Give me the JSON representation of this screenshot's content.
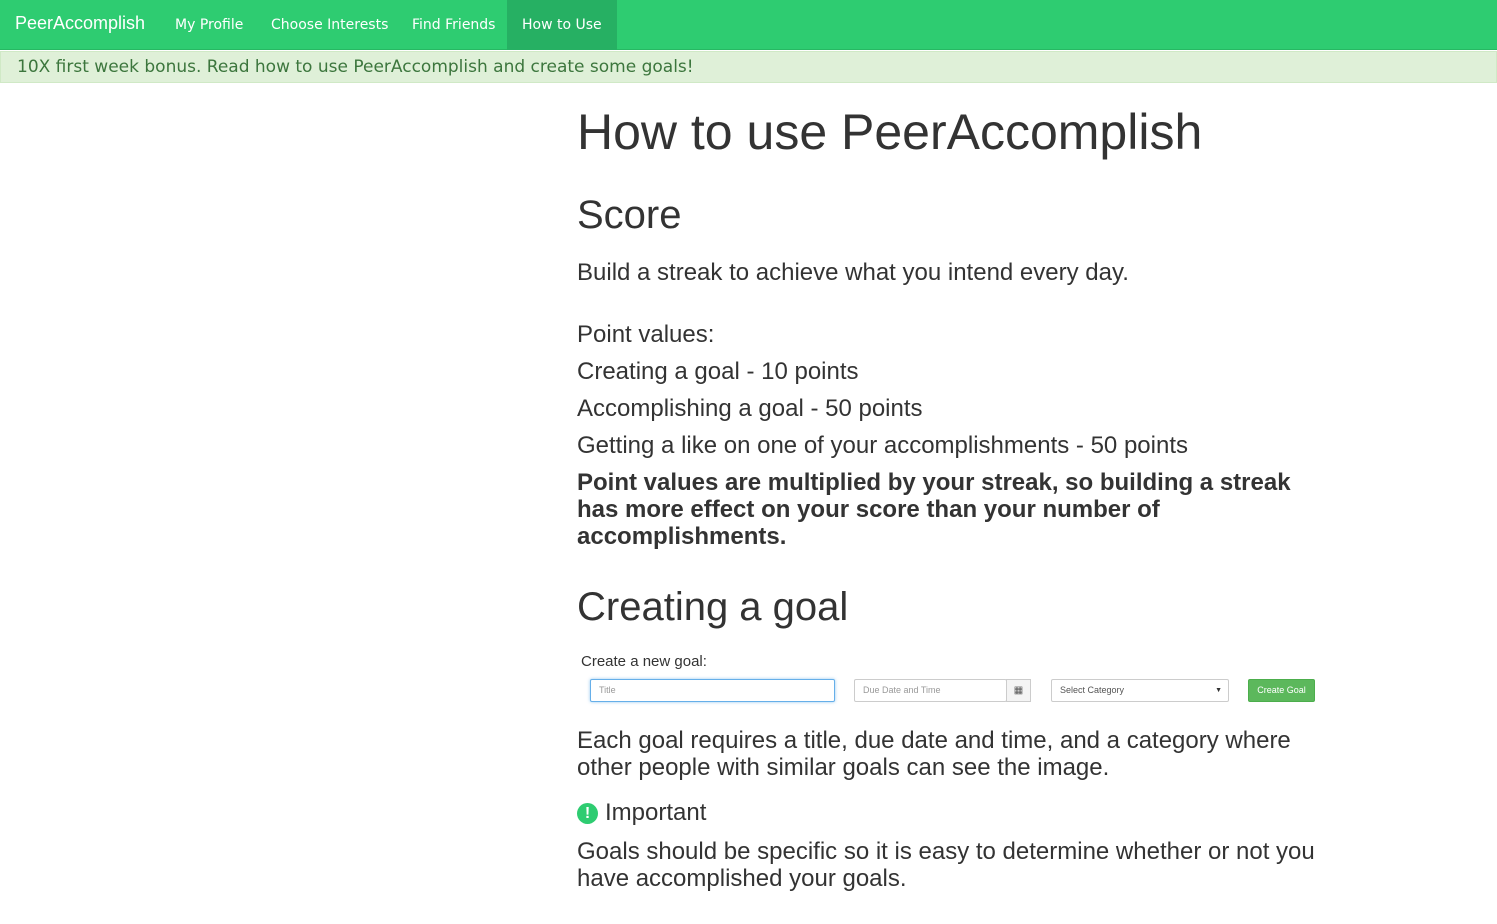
{
  "nav": {
    "brand": "PeerAccomplish",
    "items": [
      {
        "label": "My Profile"
      },
      {
        "label": "Choose Interests"
      },
      {
        "label": "Find Friends"
      },
      {
        "label": "How to Use",
        "active": true
      }
    ],
    "color": "#2ecc71"
  },
  "banner": {
    "text": "10X first week bonus. Read how to use PeerAccomplish and create some goals!"
  },
  "page": {
    "title": "How to use PeerAccomplish",
    "score": {
      "heading": "Score",
      "intro": "Build a streak to achieve what you intend every day.",
      "point_values_label": "Point values:",
      "points": [
        "Creating a goal - 10 points",
        "Accomplishing a goal - 50 points",
        "Getting a like on one of your accomplishments - 50 points"
      ],
      "note": "Point values are multiplied by your streak, so building a streak has more effect on your score than your number of accomplishments."
    },
    "creating": {
      "heading": "Creating a goal",
      "form": {
        "label": "Create a new goal:",
        "title_placeholder": "Title",
        "due_placeholder": "Due Date and Time",
        "category_selected": "Select Category",
        "button": "Create Goal"
      },
      "description": "Each goal requires a title, due date and time, and a category where other people with similar goals can see the image.",
      "important_heading": "Important",
      "important_text": "Goals should be specific so it is easy to determine whether or not you have accomplished your goals."
    }
  }
}
